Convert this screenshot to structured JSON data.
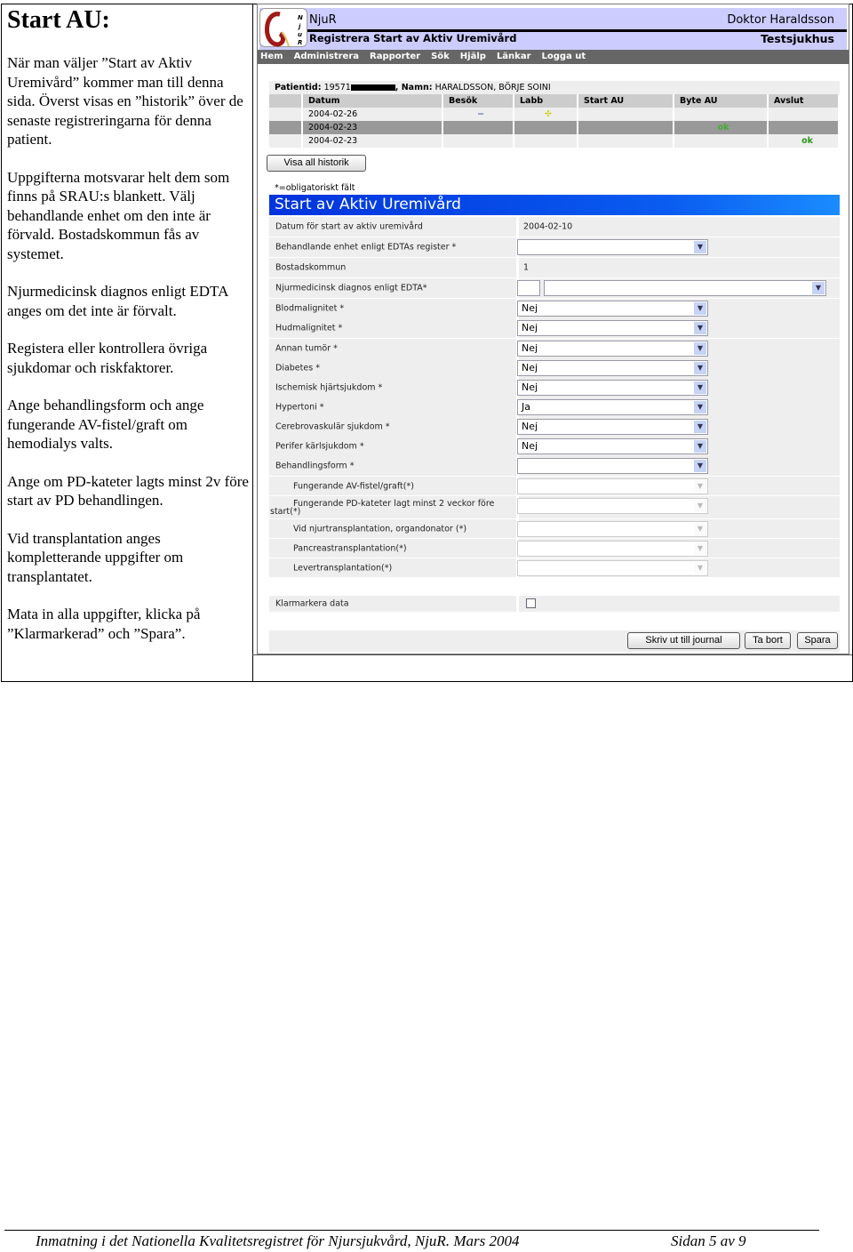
{
  "doc": {
    "title": "Start AU:",
    "paragraphs": [
      "När man väljer ”Start av Aktiv Uremivård” kommer man till denna sida. Överst visas en ”historik” över de senaste registreringarna för denna patient.",
      "Uppgifterna motsvarar helt dem som finns på SRAU:s blankett. Välj behandlande enhet om den inte är förvald. Bostadskommun fås av systemet.",
      "Njurmedicinsk diagnos enligt EDTA anges om det inte är förvalt.",
      "Registera eller kontrollera övriga sjukdomar och riskfaktorer.",
      "Ange behandlingsform och ange fungerande AV-fistel/graft om hemodialys valts.",
      "Ange om PD-kateter lagts minst 2v före start av PD behandlingen.",
      "Vid transplantation anges kompletterande uppgifter om transplantatet.",
      "Mata in alla uppgifter, klicka på ”Klarmarkerad” och ”Spara”."
    ],
    "footer_left": "Inmatning i det Nationella Kvalitetsregistret för Njursjukvård, NjuR.  Mars 2004",
    "footer_right": "Sidan 5 av 9"
  },
  "app": {
    "name": "NjuR",
    "subtitle": "Registrera Start av Aktiv Uremivård",
    "user": "Doktor Haraldsson",
    "hospital": "Testsjukhus",
    "nav": [
      "Hem",
      "Administrera",
      "Rapporter",
      "Sök",
      "Hjälp",
      "Länkar",
      "Logga ut"
    ],
    "patient_label": "Patientid:",
    "patient_id": "19571",
    "name_label": ", Namn:",
    "patient_name": "HARALDSSON, BÖRJE SOINI",
    "history_headers": [
      "",
      "Datum",
      "Besök",
      "Labb",
      "Start AU",
      "Byte AU",
      "Avslut"
    ],
    "history_rows": [
      [
        "",
        "2004-02-26",
        "−",
        "✣",
        "",
        "",
        ""
      ],
      [
        "",
        "2004-02-23",
        "",
        "",
        "",
        "ok",
        ""
      ],
      [
        "",
        "2004-02-23",
        "",
        "",
        "",
        "",
        "ok"
      ]
    ],
    "show_all": "Visa all historik",
    "mandatory_note": "*=obligatoriskt fält",
    "form_title": "Start av Aktiv Uremivård",
    "fields": [
      {
        "label": "Datum för start av aktiv uremivård",
        "value": "2004-02-10"
      },
      {
        "label": "Behandlande enhet enligt EDTAs register *",
        "value": ""
      },
      {
        "label": "Bostadskommun",
        "value": "1"
      },
      {
        "label": "Njurmedicinsk diagnos enligt EDTA*",
        "value": ""
      },
      {
        "label": "Blodmalignitet *",
        "value": "Nej"
      },
      {
        "label": "Hudmalignitet *",
        "value": "Nej"
      },
      {
        "label": "Annan tumör *",
        "value": "Nej"
      },
      {
        "label": "Diabetes *",
        "value": "Nej"
      },
      {
        "label": "Ischemisk hjärtsjukdom *",
        "value": "Nej"
      },
      {
        "label": "Hypertoni *",
        "value": "Ja"
      },
      {
        "label": "Cerebrovaskulär sjukdom *",
        "value": "Nej"
      },
      {
        "label": "Perifer kärlsjukdom *",
        "value": "Nej"
      },
      {
        "label": "Behandlingsform *",
        "value": ""
      },
      {
        "label": "Fungerande AV-fistel/graft(*)",
        "value": ""
      },
      {
        "label": "Fungerande PD-kateter lagt minst 2 veckor före",
        "label2": "start(*)",
        "value": ""
      },
      {
        "label": "Vid njurtransplantation, organdonator (*)",
        "value": ""
      },
      {
        "label": "Pancreastransplantation(*)",
        "value": ""
      },
      {
        "label": "Levertransplantation(*)",
        "value": ""
      }
    ],
    "ready_label": "Klarmarkera data",
    "ready_checked": false,
    "buttons": {
      "print": "Skriv ut till journal",
      "delete": "Ta bort",
      "save": "Spara"
    },
    "colors": {
      "header_bg": "#ccccff",
      "nav_bg": "#666666",
      "title_blue": "#0a5cf0",
      "ok_green": "#2a9a1a"
    }
  }
}
